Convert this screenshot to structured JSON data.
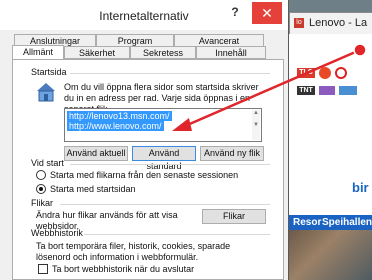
{
  "dialog": {
    "title": "Internetalternativ",
    "help_label": "?",
    "close_label": "✕",
    "tabs_row1": [
      "Anslutningar",
      "Program",
      "Avancerat"
    ],
    "tabs_row2": [
      "Allmänt",
      "Säkerhet",
      "Sekretess",
      "Innehåll"
    ],
    "active_tab": "Allmänt"
  },
  "startsida": {
    "heading": "Startsida",
    "hint": "Om du vill öppna flera sidor som startsida skriver du in en adress per rad. Varje sida öppnas i en separat flik.",
    "urls": [
      "http://lenovo13.msn.com/",
      "http://www.lenovo.com/"
    ],
    "buttons": [
      "Använd aktuell",
      "Använd standard",
      "Använd ny flik"
    ]
  },
  "vid_start": {
    "heading": "Vid start",
    "options": [
      {
        "label": "Starta med flikarna från den senaste sessionen",
        "checked": false
      },
      {
        "label": "Starta med startsidan",
        "checked": true
      }
    ]
  },
  "flikar": {
    "heading": "Flikar",
    "hint": "Ändra hur flikar används för att visa webbsidor.",
    "button": "Flikar"
  },
  "webbhistorik": {
    "heading": "Webbhistorik",
    "hint": "Ta bort temporära filer, historik, cookies, sparade lösenord och information i webbformulär.",
    "checkbox_label": "Ta bort webbhistorik när du avslutar"
  },
  "browser": {
    "tab_label": "Lenovo - La",
    "favicon_text": "lo",
    "nav_items": [
      "Resor",
      "Speihallen"
    ],
    "logo_fragment": "bir",
    "channel_chips": [
      "TLC",
      "TNT"
    ]
  },
  "colors": {
    "accent": "#3399ff",
    "arrow": "#e0252b",
    "close": "#e5413a",
    "browser_nav": "#1a63c2"
  }
}
